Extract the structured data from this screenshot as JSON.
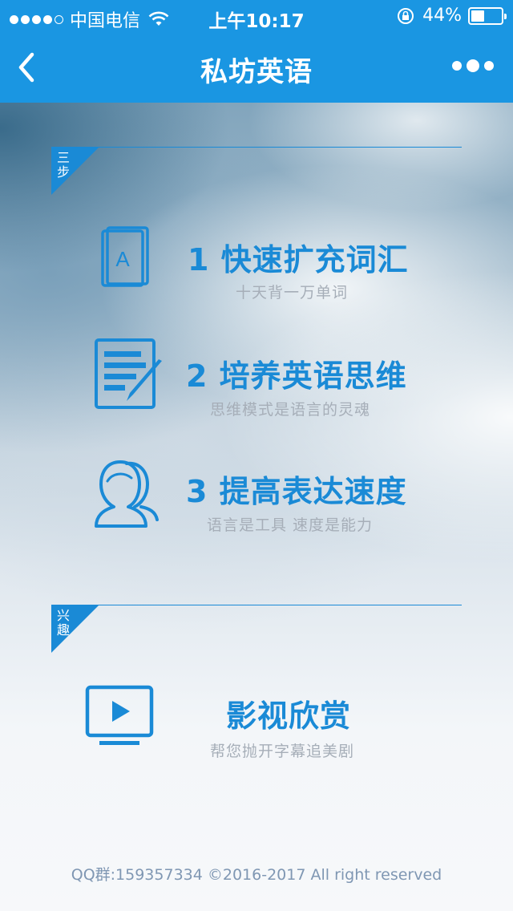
{
  "status_bar": {
    "carrier": "中国电信",
    "time": "上午10:17",
    "battery_percent": "44%",
    "battery_level": 0.44,
    "signal_bars_filled": 4,
    "signal_bars_total": 5
  },
  "nav": {
    "title": "私坊英语",
    "back_icon": "chevron-left-icon",
    "more_icon": "more-dots-icon"
  },
  "sections": {
    "steps": {
      "tag": "三步",
      "items": [
        {
          "icon": "book-letter-a-icon",
          "title": "1 快速扩充词汇",
          "subtitle": "十天背一万单词"
        },
        {
          "icon": "document-pen-icon",
          "title": "2 培养英语思维",
          "subtitle": "思维模式是语言的灵魂"
        },
        {
          "icon": "users-icon",
          "title": "3 提高表达速度",
          "subtitle": "语言是工具 速度是能力"
        }
      ]
    },
    "interest": {
      "tag": "兴趣",
      "items": [
        {
          "icon": "tv-play-icon",
          "title": "影视欣赏",
          "subtitle": "帮您抛开字幕追美剧"
        }
      ]
    }
  },
  "footer": {
    "text": "QQ群:159357334 ©2016-2017 All right reserved"
  },
  "colors": {
    "primary": "#1a96e2",
    "accent": "#1a8ad6",
    "subtitle": "#a6aeb8",
    "footer": "#7f97b3"
  }
}
